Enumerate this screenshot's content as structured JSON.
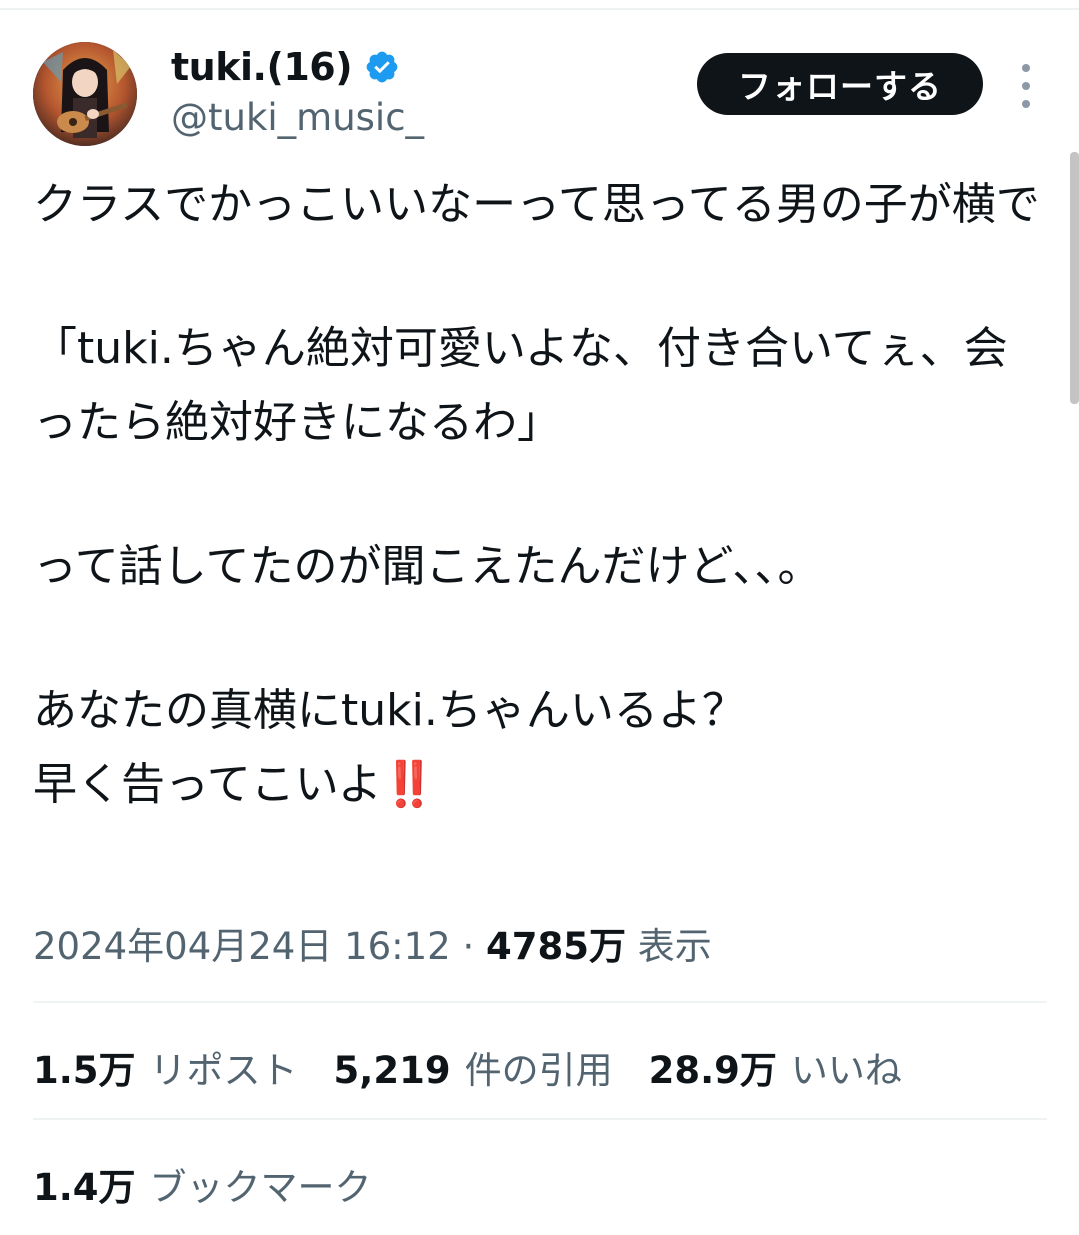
{
  "user": {
    "display_name": "tuki.(16)",
    "handle": "@tuki_music_",
    "verified": true,
    "avatar_icon": "avatar-guitar-girl"
  },
  "actions": {
    "follow_label": "フォローする",
    "more_icon": "vertical-ellipsis-icon"
  },
  "tweet": {
    "lines": [
      "クラスでかっこいいなーって思ってる男の子が横で",
      "「tuki.ちゃん絶対可愛いよな、付き合いてぇ、会ったら絶対好きになるわ」",
      "って話してたのが聞こえたんだけど､､。",
      "あなたの真横にtuki.ちゃんいるよ？",
      "早く告ってこいよ",
      "‼️"
    ]
  },
  "meta": {
    "timestamp": "2024年04月24日 16:12",
    "separator": " · ",
    "views_count": "4785万",
    "views_label": "表示"
  },
  "stats": {
    "reposts_count": "1.5万",
    "reposts_label": "リポスト",
    "quotes_count": "5,219",
    "quotes_label": "件の引用",
    "likes_count": "28.9万",
    "likes_label": "いいね",
    "bookmarks_count": "1.4万",
    "bookmarks_label": "ブックマーク"
  },
  "colors": {
    "text_primary": "#0f1419",
    "text_secondary": "#536471",
    "verified_blue": "#1d9bf0",
    "follow_bg": "#0f1419",
    "divider": "#eff3f4"
  }
}
